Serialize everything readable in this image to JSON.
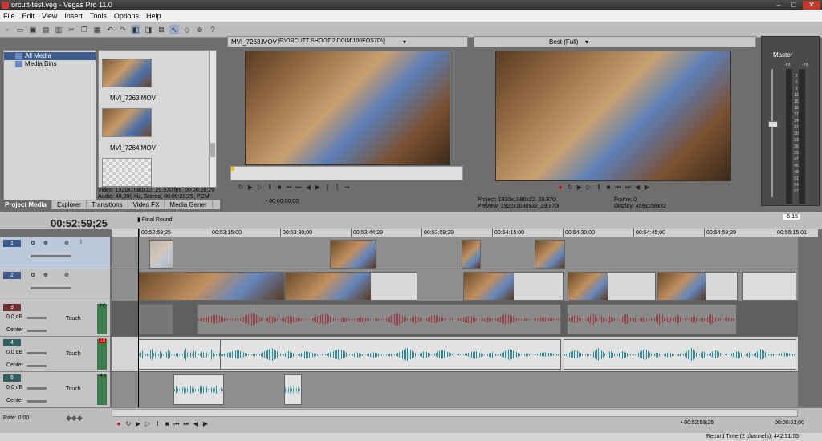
{
  "window": {
    "title": "orcutt-test.veg - Vegas Pro 11.0"
  },
  "menu": [
    "File",
    "Edit",
    "View",
    "Insert",
    "Tools",
    "Options",
    "Help"
  ],
  "media_tree": {
    "items": [
      "All Media",
      "Media Bins"
    ]
  },
  "media_files": [
    {
      "name": "MVI_7263.MOV"
    },
    {
      "name": "MVI_7264.MOV"
    }
  ],
  "media_info": {
    "line1": "Video: 1920x1080x12, 29.970 fps, 00:00:28;29",
    "line2": "Audio: 48,000 Hz, Stereo, 00:00:28;29, PCM"
  },
  "tabs": [
    "Project Media",
    "Explorer",
    "Transitions",
    "Video FX",
    "Media Gener"
  ],
  "trimmer": {
    "source_label": "MVI_7263.MOV",
    "source_path": "[F:\\ORCUTT SHOOT 2\\DCIM\\100EOS7D\\]",
    "timecode": "00:00:00;00"
  },
  "preview": {
    "quality": "Best (Full)",
    "project_label": "Project:",
    "project_value": "1920x1080x32, 29.970i",
    "preview_label": "Preview:",
    "preview_value": "1920x1080x32, 29.970i",
    "frame_label": "Frame:",
    "frame_value": "0",
    "display_label": "Display:",
    "display_value": "459x258x32"
  },
  "mixer": {
    "title": "Master",
    "scale": [
      "-Inf.",
      "-Inf.",
      "3",
      "6",
      "9",
      "12",
      "15",
      "18",
      "21",
      "24",
      "27",
      "30",
      "33",
      "36",
      "39",
      "42",
      "45",
      "48",
      "51",
      "54",
      "57"
    ]
  },
  "timeline": {
    "timecode": "00:52:59;25",
    "marker": "Final Round",
    "zoom": "-5:15",
    "ruler": [
      "00:52:59;25",
      "00:53:15:00",
      "00:53:30;00",
      "00:53:44;29",
      "00:53:59;29",
      "00:54:15:00",
      "00:54:30;00",
      "00:54:45;00",
      "00:54:59;29",
      "00:55:15:01"
    ],
    "rate_label": "Rate: 0.00",
    "cursor_time": "00:52:59;25",
    "length_time": "00:00:01;00"
  },
  "tracks": [
    {
      "num": "1",
      "type": "video"
    },
    {
      "num": "2",
      "type": "video"
    },
    {
      "num": "3",
      "type": "audio",
      "vol": "0.0 dB",
      "pan": "Center",
      "mode": "Touch",
      "peak": "-Inf."
    },
    {
      "num": "4",
      "type": "audio",
      "vol": "0.0 dB",
      "pan": "Center",
      "mode": "Touch",
      "peak": "0.0"
    },
    {
      "num": "5",
      "type": "audio",
      "vol": "0.0 dB",
      "pan": "Center",
      "mode": "Touch",
      "peak": "-4.5"
    }
  ],
  "status": {
    "record_time": "Record Time (2 channels): 442:51:55"
  },
  "colors": {
    "accent": "#3c5a8c",
    "audio_red": "#9b2f3a",
    "audio_teal": "#2d8a96"
  }
}
